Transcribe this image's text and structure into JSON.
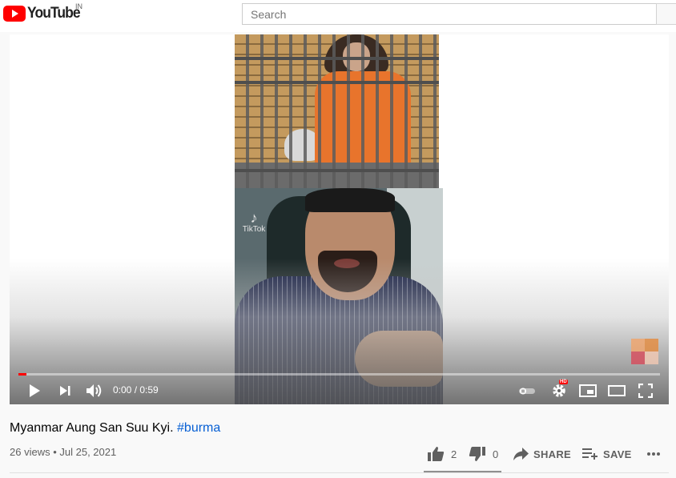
{
  "header": {
    "logo_text": "YouTube",
    "country_code": "IN",
    "search_placeholder": "Search"
  },
  "player": {
    "overlay_watermark": "TikTok",
    "time_display": "0:00 / 0:59",
    "progress_fraction": 0.013,
    "hd_badge": "HD"
  },
  "video": {
    "title": "Myanmar Aung San Suu Kyi.",
    "hashtag": "#burma",
    "views": "26 views",
    "separator": "•",
    "date": "Jul 25, 2021"
  },
  "actions": {
    "like_count": "2",
    "dislike_count": "0",
    "share_label": "SHARE",
    "save_label": "SAVE",
    "like_fraction": 1.0
  },
  "colors": {
    "brand_red": "#ff0000",
    "link_blue": "#065fd4",
    "meta_gray": "#606060"
  },
  "icons": [
    "youtube-logo-icon",
    "play-icon",
    "next-icon",
    "volume-icon",
    "autoplay-toggle-icon",
    "settings-gear-icon",
    "miniplayer-icon",
    "theater-mode-icon",
    "fullscreen-icon",
    "thumbs-up-icon",
    "thumbs-down-icon",
    "share-arrow-icon",
    "playlist-add-icon",
    "more-horiz-icon"
  ]
}
